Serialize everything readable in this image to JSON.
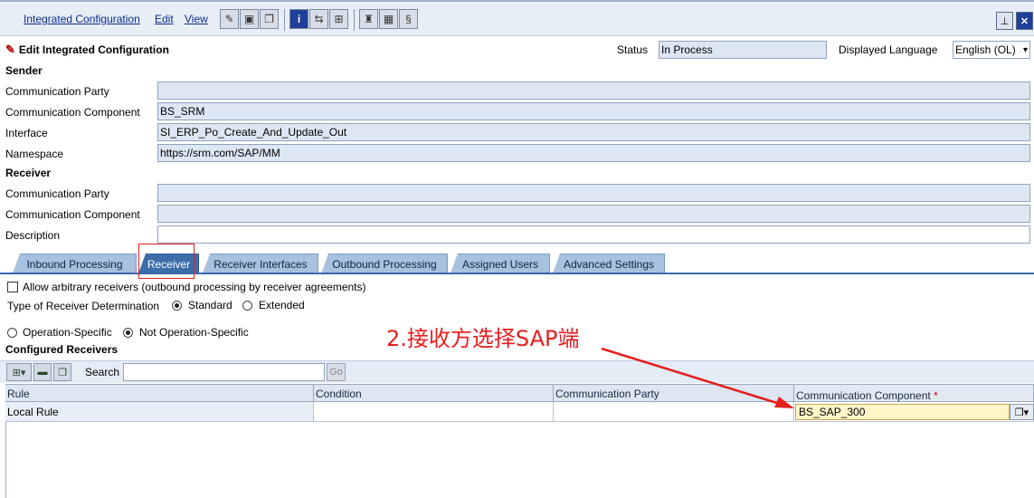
{
  "menu": {
    "integrated_configuration": "Integrated Configuration",
    "edit": "Edit",
    "view": "View"
  },
  "header": {
    "title": "Edit Integrated Configuration",
    "status_label": "Status",
    "status_value": "In Process",
    "language_label": "Displayed Language",
    "language_value": "English (OL)"
  },
  "sender": {
    "heading": "Sender",
    "party_label": "Communication Party",
    "party_value": "",
    "component_label": "Communication Component",
    "component_value": "BS_SRM",
    "interface_label": "Interface",
    "interface_value": "SI_ERP_Po_Create_And_Update_Out",
    "namespace_label": "Namespace",
    "namespace_value": "https://srm.com/SAP/MM"
  },
  "receiver": {
    "heading": "Receiver",
    "party_label": "Communication Party",
    "party_value": "",
    "component_label": "Communication Component",
    "component_value": "",
    "description_label": "Description",
    "description_value": ""
  },
  "tabs": [
    "Inbound Processing",
    "Receiver",
    "Receiver Interfaces",
    "Outbound Processing",
    "Assigned Users",
    "Advanced Settings"
  ],
  "active_tab": "Receiver",
  "receiver_tab": {
    "allow_arbitrary": "Allow arbitrary receivers (outbound processing by receiver agreements)",
    "type_label": "Type of Receiver Determination",
    "standard": "Standard",
    "extended": "Extended",
    "operation_specific": "Operation-Specific",
    "not_operation_specific": "Not Operation-Specific",
    "configured_receivers": "Configured Receivers",
    "search_label": "Search",
    "search_value": "",
    "go": "Go"
  },
  "grid": {
    "columns": [
      "Rule",
      "Condition",
      "Communication Party",
      "Communication Component"
    ],
    "required_marker": "*",
    "rows": [
      {
        "rule": "Local Rule",
        "condition": "",
        "party": "",
        "component": "BS_SAP_300"
      }
    ]
  },
  "annotation": {
    "text": "2.接收方选择SAP端",
    "color": "#e61e1e"
  }
}
